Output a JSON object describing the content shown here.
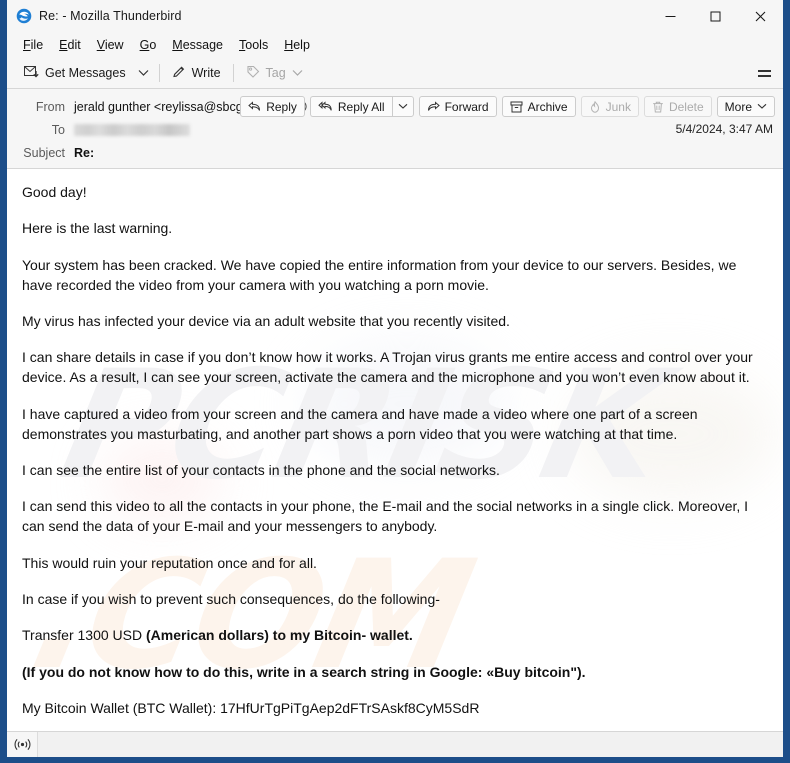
{
  "window": {
    "title": "Re: - Mozilla Thunderbird",
    "app_icon": "thunderbird-bird-icon",
    "minimize_label": "─",
    "maximize_label": "☐",
    "close_label": "✕",
    "border_color": "#1d4e89"
  },
  "menubar": {
    "items": [
      {
        "label": "File",
        "accesskey": "F"
      },
      {
        "label": "Edit",
        "accesskey": "E"
      },
      {
        "label": "View",
        "accesskey": "V"
      },
      {
        "label": "Go",
        "accesskey": "G"
      },
      {
        "label": "Message",
        "accesskey": "M"
      },
      {
        "label": "Tools",
        "accesskey": "T"
      },
      {
        "label": "Help",
        "accesskey": "H"
      }
    ]
  },
  "toolbar": {
    "get_messages_label": "Get Messages",
    "get_messages_chevron": "⌄",
    "write_label": "Write",
    "tag_label": "Tag",
    "tag_chevron": "⌄",
    "tag_disabled": true,
    "app_menu_label": "app-menu"
  },
  "message_header": {
    "from_label": "From",
    "from_value": "jerald gunther <reylissa@sbcgbal.net>",
    "from_badge_icon": "add-contact-icon",
    "to_label": "To",
    "to_value_redacted": true,
    "subject_label": "Subject",
    "subject_value": "Re:",
    "date": "5/4/2024, 3:47 AM",
    "actions": [
      {
        "label": "Reply",
        "icon": "reply-arrow-icon",
        "disabled": false
      },
      {
        "label": "Reply All",
        "icon": "reply-all-arrow-icon",
        "disabled": false
      },
      {
        "label": "Forward",
        "icon": "forward-arrow-icon",
        "disabled": false
      },
      {
        "label": "Archive",
        "icon": "archive-box-icon",
        "disabled": false
      },
      {
        "label": "Junk",
        "icon": "junk-flame-icon",
        "disabled": true
      },
      {
        "label": "Delete",
        "icon": "trash-can-icon",
        "disabled": true
      },
      {
        "label": "More",
        "icon": "chevron-down-icon",
        "disabled": false
      }
    ],
    "reply_all_chevron": "⌄",
    "more_chevron": "⌄"
  },
  "message_body": {
    "paragraphs": [
      "Good day!",
      "Here is the last warning.",
      "Your system has been cracked. We have copied the entire information from your device to our servers. Besides, we have recorded the video from your camera with you watching a porn movie.",
      "My virus has infected your device via an adult website that you recently visited.",
      "I can share details in case if you don’t know how it works. A Trojan virus grants me entire access and control over your device. As a result, I can see your screen, activate the camera and the microphone and you won’t even know about it.",
      "I have captured a video from your screen and the camera and have made a video where one part of a screen demonstrates you masturbating, and another part shows a porn video that you were watching at that time.",
      "I can see the entire list of your contacts in the phone and the social networks.",
      "I can send this video to all the contacts in your phone, the E-mail and the social networks in a single click. Moreover, I can send the data of your E-mail and your messengers to anybody.",
      "This would ruin your reputation once and for all.",
      "In case if you wish to prevent such consequences, do the following-"
    ],
    "transfer_plain": "Transfer 1300 USD ",
    "transfer_bold": "(American dollars) to my Bitcoin- wallet.",
    "google_search_bold": "(If you do not know how to do this, write in a search string in Google: «Buy bitcoin\").",
    "wallet_line": "My Bitcoin Wallet (BTC Wallet): 17HfUrTgPiTgAep2dFTrSAskf8CyM5SdR",
    "watermark_1": "PCRISK",
    "watermark_2": ".COM"
  },
  "statusbar": {
    "connection_icon": "network-signal-icon",
    "text": ""
  }
}
